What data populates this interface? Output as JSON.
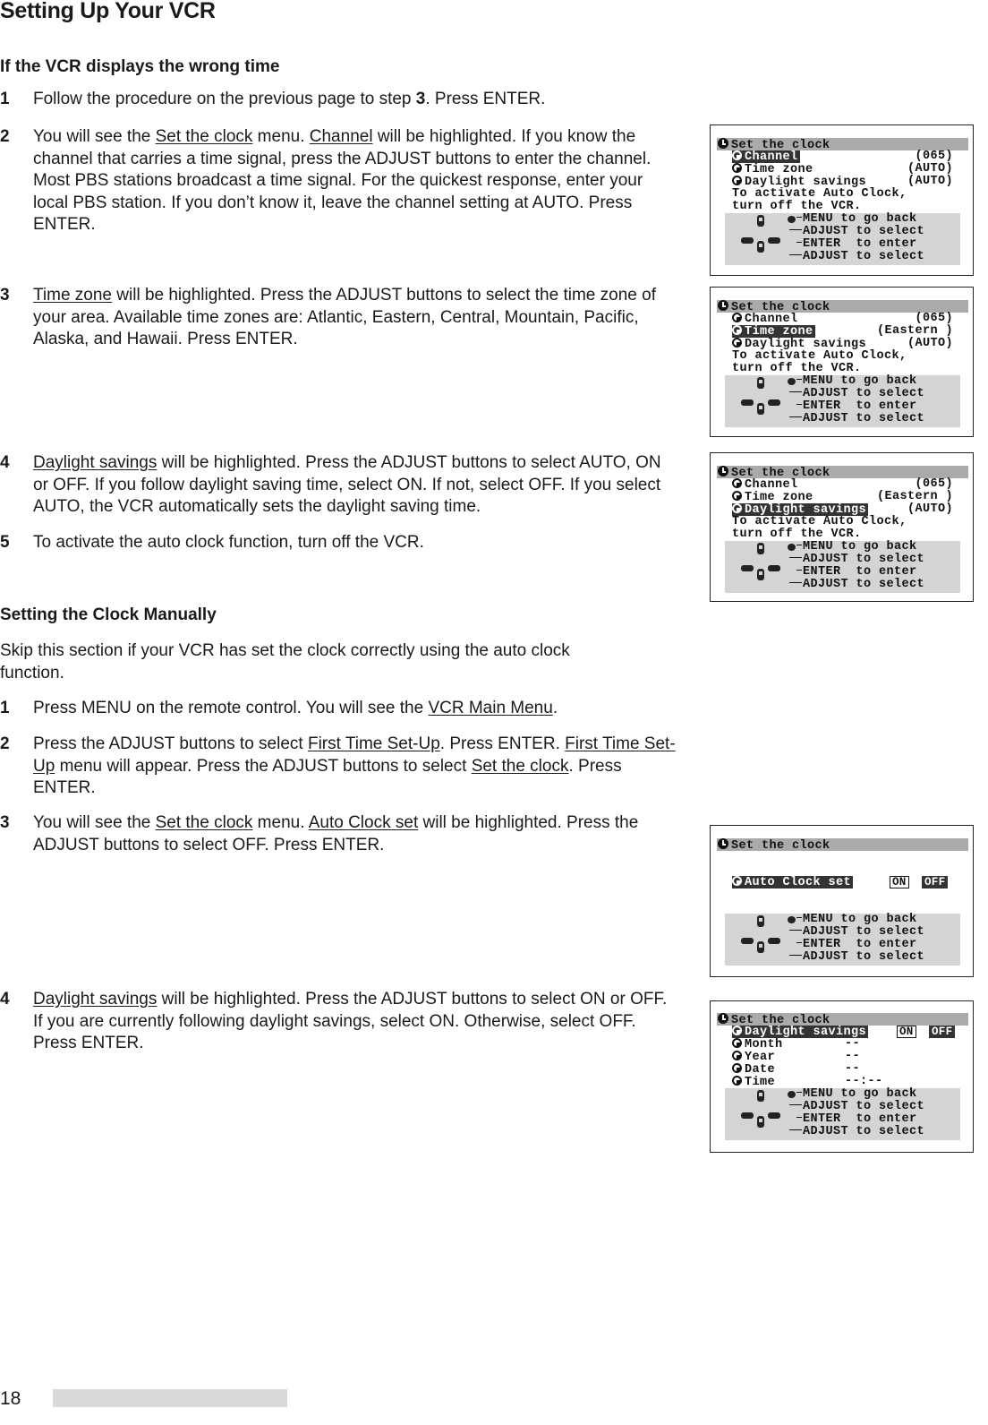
{
  "page": {
    "title": "Setting Up Your VCR",
    "page_number": "18"
  },
  "auto_section": {
    "heading": "If the VCR displays the wrong time",
    "steps": [
      {
        "num": "1",
        "parts": [
          [
            "Follow the procedure on the previous page to step ",
            ""
          ],
          [
            "3",
            "b"
          ],
          [
            ".  Press ENTER.",
            ""
          ]
        ]
      },
      {
        "num": "2",
        "parts": [
          [
            "You will see the ",
            ""
          ],
          [
            "Set the clock",
            "u"
          ],
          [
            " menu.  ",
            ""
          ],
          [
            "Channel",
            "u"
          ],
          [
            " will be highlighted.  If you know the channel that carries a time signal, press the ADJUST buttons to enter the channel.  Most PBS stations broadcast a time signal.  For the quickest response, enter your local PBS station.  If you don’t know it, leave the channel setting at AUTO.  Press ENTER.",
            ""
          ]
        ]
      },
      {
        "num": "3",
        "parts": [
          [
            "Time zone",
            "u"
          ],
          [
            " will be highlighted.  Press the ADJUST buttons to select the time zone of your area.  Available time zones are:  Atlantic, Eastern, Central, Mountain, Pacific, Alaska, and Hawaii.  Press ENTER.",
            ""
          ]
        ]
      },
      {
        "num": "4",
        "parts": [
          [
            "Daylight savings",
            "u"
          ],
          [
            " will be highlighted.  Press the ADJUST buttons to select AUTO, ON or OFF.  If you follow daylight saving time, select ON.  If not, select OFF.  If you select AUTO, the VCR automatically sets the daylight saving time.",
            ""
          ]
        ]
      },
      {
        "num": "5",
        "parts": [
          [
            "To activate the auto clock function, turn off the VCR.",
            ""
          ]
        ]
      }
    ]
  },
  "manual_section": {
    "heading": "Setting the Clock Manually",
    "intro": "Skip this section if your VCR has set the clock correctly using the auto clock function.",
    "steps": [
      {
        "num": "1",
        "parts": [
          [
            "Press MENU on the remote control.  You will see the ",
            ""
          ],
          [
            "VCR Main Menu",
            "u"
          ],
          [
            ".",
            ""
          ]
        ]
      },
      {
        "num": "2",
        "parts": [
          [
            "Press the ADJUST buttons to select ",
            ""
          ],
          [
            "First Time Set-Up",
            "u"
          ],
          [
            ".  Press ENTER.  ",
            ""
          ],
          [
            "First Time Set-Up",
            "u"
          ],
          [
            " menu will appear.  Press the ADJUST buttons to select ",
            ""
          ],
          [
            "Set the clock",
            "u"
          ],
          [
            ".  Press ENTER.",
            ""
          ]
        ]
      },
      {
        "num": "3",
        "parts": [
          [
            "You will see the ",
            ""
          ],
          [
            "Set the clock",
            "u"
          ],
          [
            " menu.  ",
            ""
          ],
          [
            "Auto Clock set",
            "u"
          ],
          [
            " will be highlighted.  Press the ADJUST buttons to select OFF.  Press ENTER.",
            ""
          ]
        ]
      },
      {
        "num": "4",
        "parts": [
          [
            "Daylight savings",
            "u"
          ],
          [
            " will be highlighted.  Press the ADJUST buttons to select ON or OFF.  If you are currently following daylight savings, select ON.  Otherwise, select OFF.  Press ENTER.",
            ""
          ]
        ]
      }
    ]
  },
  "osd": {
    "menu_title": "Set the clock",
    "note_line1": "To activate Auto Clock,",
    "note_line2": "turn off the VCR.",
    "help": {
      "menu": "MENU to go back",
      "adjust_up": "ADJUST to select",
      "enter": "ENTER  to enter",
      "adjust_down": "ADJUST to select"
    },
    "screen1": {
      "items": [
        {
          "label": "Channel",
          "value": "(065)",
          "selected": true
        },
        {
          "label": "Time zone",
          "value": "(AUTO)",
          "selected": false
        },
        {
          "label": "Daylight savings",
          "value": "(AUTO)",
          "selected": false
        }
      ]
    },
    "screen2": {
      "items": [
        {
          "label": "Channel",
          "value": "(065)",
          "selected": false
        },
        {
          "label": "Time zone",
          "value": "(Eastern )",
          "selected": true
        },
        {
          "label": "Daylight savings",
          "value": "(AUTO)",
          "selected": false
        }
      ]
    },
    "screen3": {
      "items": [
        {
          "label": "Channel",
          "value": "(065)",
          "selected": false
        },
        {
          "label": "Time zone",
          "value": "(Eastern )",
          "selected": false
        },
        {
          "label": "Daylight savings",
          "value": "(AUTO)",
          "selected": true
        }
      ]
    },
    "screen4": {
      "item": "Auto Clock set",
      "on": "ON",
      "off": "OFF",
      "selected_option": "OFF"
    },
    "screen5": {
      "highlight": "Daylight savings",
      "on": "ON",
      "off": "OFF",
      "selected_option": "OFF",
      "items": [
        {
          "label": "Month",
          "value": "--"
        },
        {
          "label": "Year",
          "value": "--"
        },
        {
          "label": "Date",
          "value": "--"
        },
        {
          "label": "Time",
          "value": "--:--"
        }
      ]
    }
  },
  "colors": {
    "osd_title_bar": "#aaaaaa",
    "osd_help_bg": "#d4d4d4",
    "osd_highlight": "#333333",
    "footer_bar": "#d9d9d9"
  }
}
